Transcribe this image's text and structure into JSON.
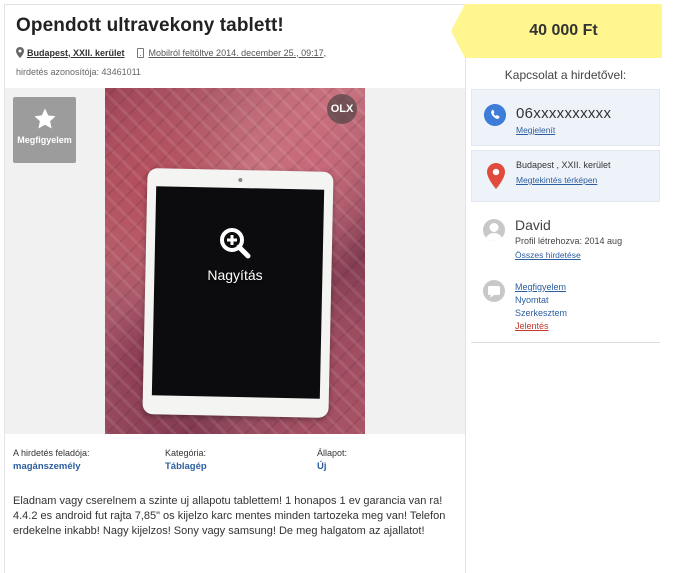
{
  "ad": {
    "title": "Opendott ultravekony tablett!",
    "location": "Budapest, XXII. kerület",
    "posted": "Mobilról feltöltve 2014. december 25., 09:17,",
    "ad_id": "hirdetés azonosítója: 43461011"
  },
  "gallery": {
    "watch_label": "Megfigyelem",
    "zoom_label": "Nagyítás",
    "watermark": "OLX"
  },
  "details": [
    {
      "key": "A hirdetés feladója:",
      "value": "magánszemély"
    },
    {
      "key": "Kategória:",
      "value": "Táblagép"
    },
    {
      "key": "Állapot:",
      "value": "Új"
    }
  ],
  "description": "Eladnam vagy cserelnem a szinte uj allapotu tablettem! 1 honapos 1 ev garancia van ra! 4.4.2 es android fut rajta 7,85\" os kijelzo karc mentes minden tartozeka meg van! Telefon erdekelne inkabb! Nagy kijelzos! Sony vagy samsung! De meg halgatom az ajallatot!",
  "price": "40 000 Ft",
  "contact": {
    "title": "Kapcsolat a hirdetővel:",
    "phone": "06xxxxxxxxxx",
    "phone_show": "Megjelenít",
    "location": "Budapest , XXII. kerület",
    "map_link": "Megtekintés térképen"
  },
  "user": {
    "name": "David",
    "since": "Profil létrehozva: 2014 aug",
    "all_ads": "Összes hirdetése"
  },
  "actions": {
    "watch": "Megfigyelem",
    "print": "Nyomtat",
    "edit": "Szerkesztem",
    "report": "Jelentés"
  },
  "colors": {
    "price_bg": "#fff68f",
    "link": "#2c5e9e",
    "phone_icon": "#3d7dd8",
    "pin_icon": "#e14b3c",
    "report": "#c0392b"
  }
}
